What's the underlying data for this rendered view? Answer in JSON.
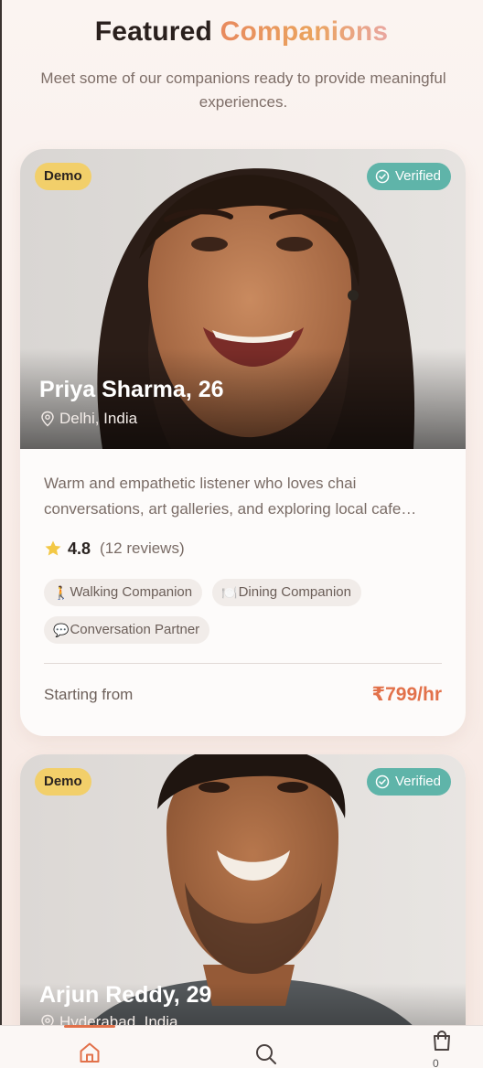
{
  "header": {
    "title_part1": "Featured",
    "title_part2": "Companions",
    "subtitle": "Meet some of our companions ready to provide meaningful experiences."
  },
  "companions": [
    {
      "badge_demo": "Demo",
      "badge_verified": "Verified",
      "name": "Priya Sharma, 26",
      "location": "Delhi, India",
      "bio_line1": "Warm and empathetic listener who loves chai",
      "bio_line2": "conversations, art galleries, and exploring local cafe…",
      "rating": "4.8",
      "reviews": "(12 reviews)",
      "tags": [
        {
          "emoji": "🚶",
          "label": "Walking Companion"
        },
        {
          "emoji": "🍽️",
          "label": "Dining Companion"
        },
        {
          "emoji": "💬",
          "label": "Conversation Partner"
        }
      ],
      "price_label": "Starting from",
      "price": "₹799/hr"
    },
    {
      "badge_demo": "Demo",
      "badge_verified": "Verified",
      "name": "Arjun Reddy, 29",
      "location": "Hyderabad, India"
    }
  ],
  "bottom_nav": {
    "items": [
      {
        "icon": "home-icon",
        "active": true
      },
      {
        "icon": "search-icon",
        "active": false
      },
      {
        "icon": "cart-icon",
        "active": false
      }
    ],
    "cart_count": "0"
  },
  "colors": {
    "accent": "#e2714a",
    "demo_badge": "#f2cf6a",
    "verified_badge": "#5fb4a9"
  }
}
